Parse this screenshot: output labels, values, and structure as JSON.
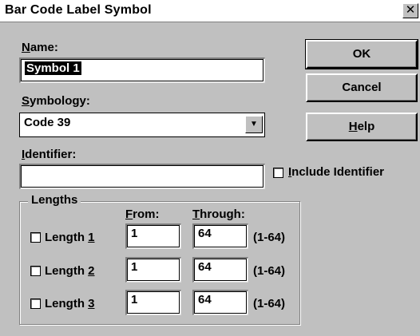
{
  "window": {
    "title": "Bar Code Label Symbol",
    "close_glyph": "✕"
  },
  "name": {
    "label": "Name:",
    "value": "Symbol 1"
  },
  "symbology": {
    "label": "Symbology:",
    "value": "Code 39"
  },
  "identifier": {
    "label": "Identifier:",
    "value": "",
    "include_label": "Include Identifier",
    "include_checked": false
  },
  "buttons": {
    "ok": "OK",
    "cancel": "Cancel",
    "help": "Help"
  },
  "lengths": {
    "group_label": "Lengths",
    "from_header": "From:",
    "through_header": "Through:",
    "rows": [
      {
        "label": "Length 1",
        "checked": false,
        "from": "1",
        "through": "64",
        "range": "(1-64)"
      },
      {
        "label": "Length 2",
        "checked": false,
        "from": "1",
        "through": "64",
        "range": "(1-64)"
      },
      {
        "label": "Length 3",
        "checked": false,
        "from": "1",
        "through": "64",
        "range": "(1-64)"
      }
    ]
  },
  "icons": {
    "dropdown": "chevron-down-icon",
    "close": "close-icon"
  }
}
